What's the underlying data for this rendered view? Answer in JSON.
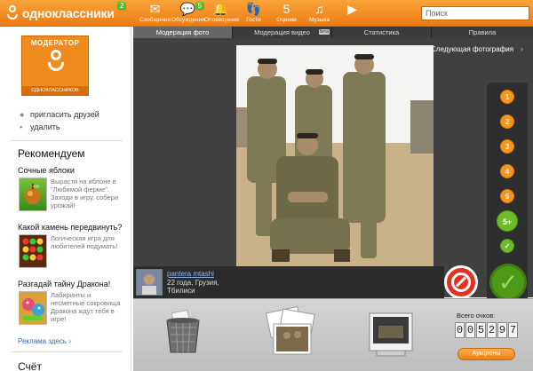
{
  "topbar": {
    "site_name": "одноклассники",
    "logo_badge": "2",
    "search_placeholder": "Поиск",
    "nav": [
      {
        "label": "Сообщения",
        "icon": "envelope-icon",
        "glyph": "✉"
      },
      {
        "label": "Обсуждения",
        "icon": "chat-icon",
        "glyph": "💬",
        "badge": "5"
      },
      {
        "label": "Оповещения",
        "icon": "bell-icon",
        "glyph": "🔔"
      },
      {
        "label": "Гости",
        "icon": "footprints-icon",
        "glyph": "👣"
      },
      {
        "label": "Оценки",
        "icon": "five-plus-icon",
        "glyph": "5"
      },
      {
        "label": "Музыка",
        "icon": "music-icon",
        "glyph": "♫"
      },
      {
        "label": "",
        "icon": "play-icon",
        "glyph": "▶"
      }
    ]
  },
  "sidebar": {
    "moderator_title": "МОДЕРАТОР",
    "moderator_foot": "ОДНОКЛАССНИКОВ",
    "invite_label": "пригласить друзей",
    "delete_label": "удалить",
    "recommend_title": "Рекомендуем",
    "games": [
      {
        "title": "Сочные яблоки",
        "desc": "Вырасти на яблоне в \"Любимой ферме\". Заходи в игру, собери урожай!"
      },
      {
        "title": "Какой камень передвинуть?",
        "desc": "Логическая игра для любителей подумать!"
      },
      {
        "title": "Разгадай тайну Дракона!",
        "desc": "Лабиринты и несметные сокровища Дракона ждут тебя в игре!"
      }
    ],
    "more_link": "Реклама здесь ›",
    "count_title": "Счёт"
  },
  "tabs": [
    {
      "label": "Модерация фото",
      "active": true
    },
    {
      "label": "Модерация видео",
      "beta": "бета"
    },
    {
      "label": "Статистика"
    },
    {
      "label": "Правила"
    }
  ],
  "stage": {
    "next_photo": "Следующая фотография",
    "scale": [
      "1",
      "2",
      "3",
      "4",
      "5",
      "5+"
    ],
    "user": {
      "name": "pantera mtashi",
      "info": "22 года, Грузия, Тбилиси"
    }
  },
  "tray": {
    "score_label": "Всего очков:",
    "score_digits": [
      "0",
      "0",
      "5",
      "2",
      "9",
      "7"
    ],
    "auction_label": "Аукционы"
  },
  "colors": {
    "brand_orange": "#f08b1d",
    "accept_green": "#4e9a17",
    "reject_red": "#e33022"
  }
}
